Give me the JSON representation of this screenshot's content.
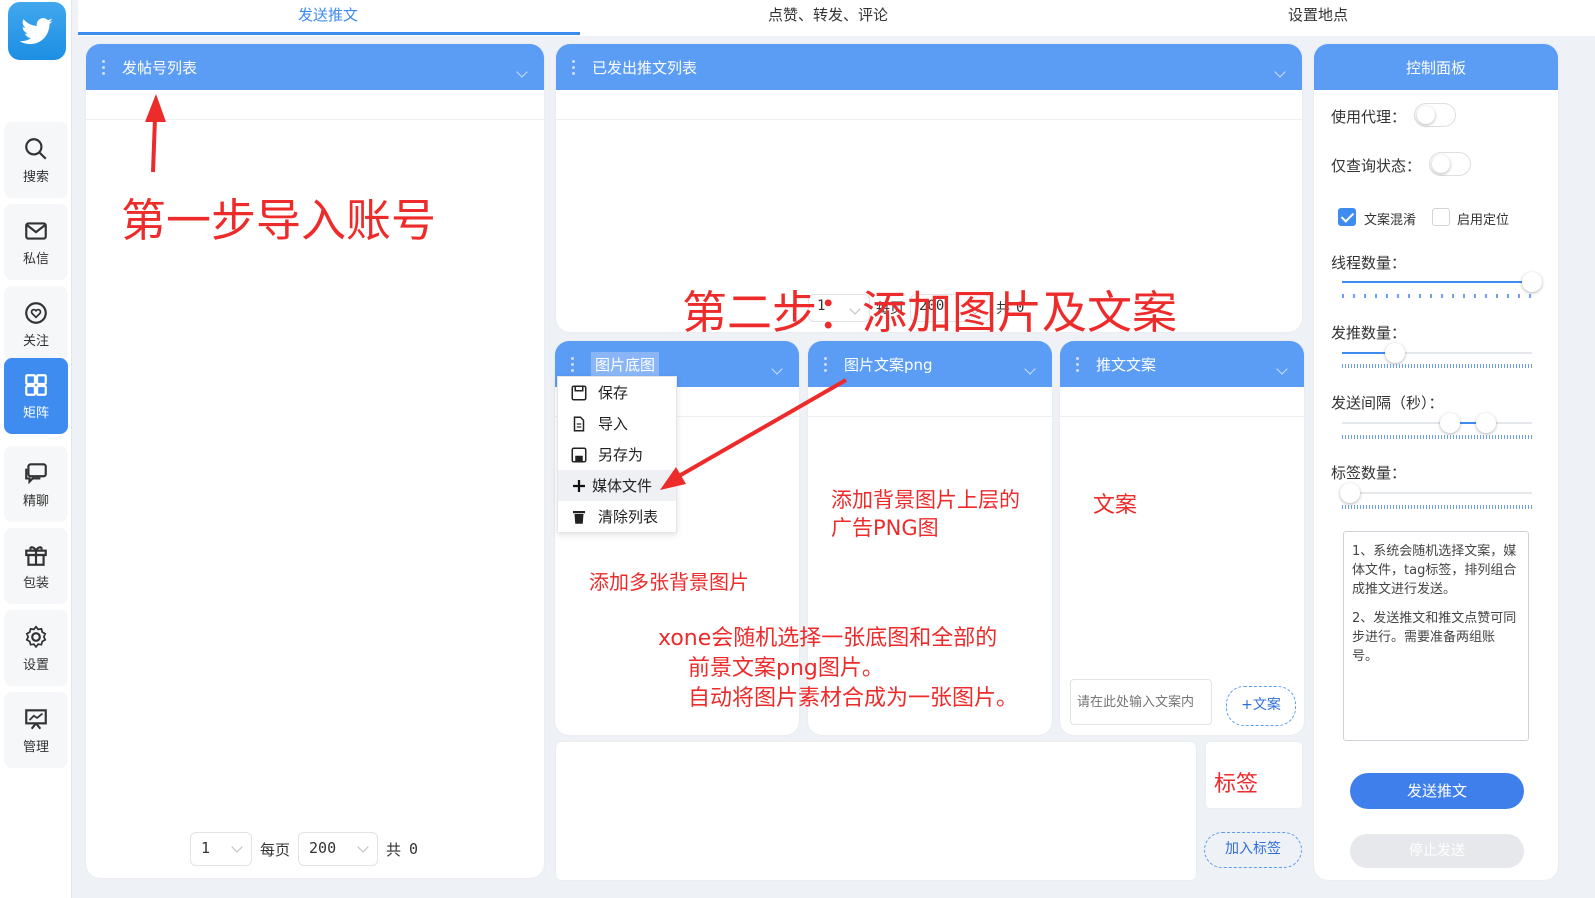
{
  "colors": {
    "accent": "#3f8cf0",
    "panel_header": "#5b9cf5",
    "annotation": "#ee2b2b"
  },
  "tabs": [
    {
      "label": "发送推文",
      "active": true
    },
    {
      "label": "点赞、转发、评论",
      "active": false
    },
    {
      "label": "设置地点",
      "active": false
    }
  ],
  "nav": [
    {
      "label": "搜索",
      "icon": "search-icon"
    },
    {
      "label": "私信",
      "icon": "mail-icon"
    },
    {
      "label": "关注",
      "icon": "heart-icon"
    },
    {
      "label": "矩阵",
      "icon": "grid-icon",
      "active": true
    },
    {
      "label": "精聊",
      "icon": "chat-icon"
    },
    {
      "label": "包装",
      "icon": "gift-icon"
    },
    {
      "label": "设置",
      "icon": "gear-icon"
    },
    {
      "label": "管理",
      "icon": "presentation-icon"
    }
  ],
  "accounts_panel": {
    "title": "发帖号列表",
    "pager": {
      "page": "1",
      "per_page_label": "每页",
      "per_page": "200",
      "total_label": "共",
      "total": "0"
    }
  },
  "sent_panel": {
    "title": "已发出推文列表",
    "pager": {
      "page": "1",
      "per_page_label": "每页",
      "per_page": "200",
      "total_label": "共",
      "total": "0"
    }
  },
  "bg_panel": {
    "title": "图片底图"
  },
  "png_panel": {
    "title": "图片文案png"
  },
  "copy_panel": {
    "title": "推文文案",
    "input_placeholder": "请在此处输入文案内",
    "add_button": "+文案"
  },
  "context_menu": [
    {
      "label": "保存",
      "icon": "save-icon"
    },
    {
      "label": "导入",
      "icon": "file-icon"
    },
    {
      "label": "另存为",
      "icon": "save-as-icon"
    },
    {
      "label": "媒体文件",
      "icon": "plus-icon",
      "highlight": true
    },
    {
      "label": "清除列表",
      "icon": "trash-icon"
    }
  ],
  "tags": {
    "add_button": "加入标签"
  },
  "control": {
    "title": "控制面板",
    "use_proxy": {
      "label": "使用代理：",
      "on": false
    },
    "query_only": {
      "label": "仅查询状态：",
      "on": false
    },
    "text_mix": {
      "label": "文案混淆",
      "checked": true
    },
    "enable_location": {
      "label": "启用定位",
      "checked": false
    },
    "threads": {
      "label": "线程数量：",
      "value": 1.0
    },
    "tweets": {
      "label": "发推数量：",
      "value": 0.28
    },
    "interval": {
      "label": "发送间隔（秒）：",
      "range": [
        0.57,
        0.76
      ]
    },
    "tag_count": {
      "label": "标签数量：",
      "value": 0.04
    },
    "notes": [
      "1、系统会随机选择文案，媒体文件，tag标签，排列组合成推文进行发送。",
      "2、发送推文和推文点赞可同步进行。需要准备两组账号。"
    ],
    "send_button": "发送推文",
    "stop_button": "停止发送"
  },
  "annotations": {
    "step1": "第一步导入账号",
    "step2": "第二步：添加图片及文案",
    "multi_bg": "添加多张背景图片",
    "png_line1": "添加背景图片上层的",
    "png_line2": "广告PNG图",
    "copy": "文案",
    "tag": "标签",
    "xone_line1": "xone会随机选择一张底图和全部的",
    "xone_line2": "前景文案png图片。",
    "xone_line3": "自动将图片素材合成为一张图片。"
  }
}
